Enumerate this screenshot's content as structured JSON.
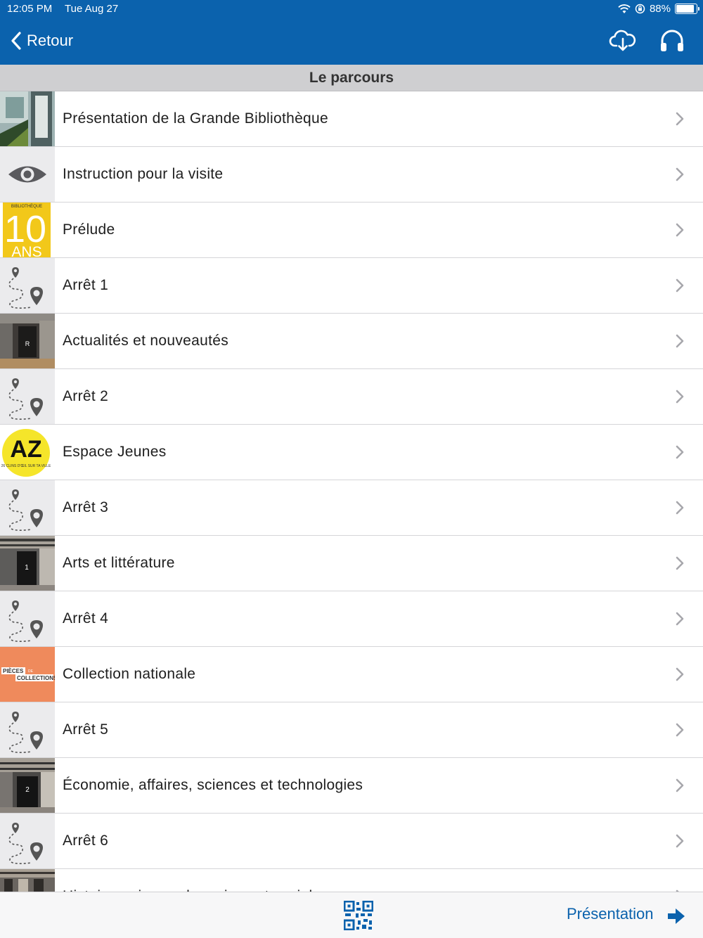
{
  "status_bar": {
    "time": "12:05 PM",
    "date": "Tue Aug 27",
    "battery": "88%"
  },
  "nav": {
    "back_label": "Retour"
  },
  "section": {
    "title": "Le parcours"
  },
  "items": [
    {
      "label": "Présentation de la Grande Bibliothèque",
      "thumb": "building-photo"
    },
    {
      "label": "Instruction pour la visite",
      "thumb": "eye-icon"
    },
    {
      "label": "Prélude",
      "thumb": "bibliotheque-10-ans-logo"
    },
    {
      "label": "Arrêt 1",
      "thumb": "route-pin-icon"
    },
    {
      "label": "Actualités et nouveautés",
      "thumb": "sign-r-photo"
    },
    {
      "label": "Arrêt 2",
      "thumb": "route-pin-icon"
    },
    {
      "label": "Espace Jeunes",
      "thumb": "az-logo"
    },
    {
      "label": "Arrêt 3",
      "thumb": "route-pin-icon"
    },
    {
      "label": "Arts et littérature",
      "thumb": "sign-1-photo"
    },
    {
      "label": "Arrêt 4",
      "thumb": "route-pin-icon"
    },
    {
      "label": "Collection nationale",
      "thumb": "pieces-de-collections-logo"
    },
    {
      "label": "Arrêt 5",
      "thumb": "route-pin-icon"
    },
    {
      "label": "Économie, affaires, sciences et technologies",
      "thumb": "sign-2-photo"
    },
    {
      "label": "Arrêt 6",
      "thumb": "route-pin-icon"
    },
    {
      "label": "Histoire, sciences humaines et sociales",
      "thumb": "shelves-photo"
    }
  ],
  "thumb_text": {
    "prelude_top": "BIBLIOTHÈQUE",
    "prelude_number": "10",
    "prelude_bottom": "ANS",
    "sign_r": "R",
    "sign_1": "1",
    "sign_2": "2",
    "az": "AZ",
    "az_sub": "26 CLINS D'ŒIL SUR TA VILLE",
    "pieces_top": "PIÈCES",
    "pieces_de": "DE",
    "pieces_bottom": "COLLECTIONS"
  },
  "bottom": {
    "next_label": "Présentation"
  },
  "colors": {
    "brand_blue": "#0b62ad",
    "prelude_yellow": "#f2c81a",
    "az_yellow": "#f5e52a",
    "collection_orange": "#ef8a5c"
  }
}
